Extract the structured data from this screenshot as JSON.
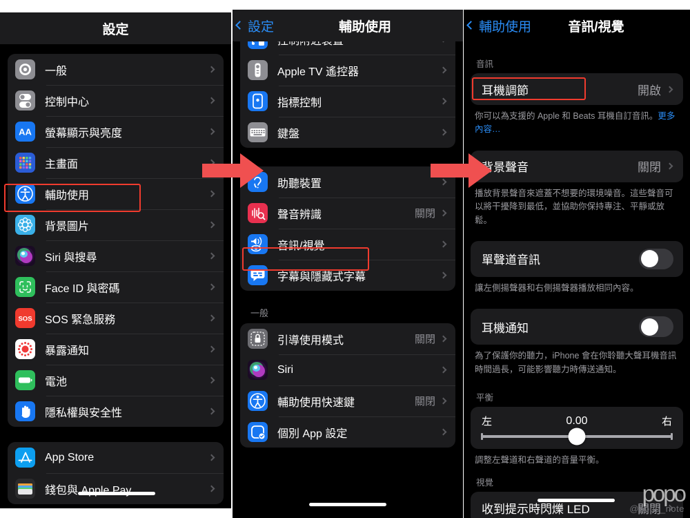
{
  "panel1": {
    "nav": {
      "title": "設定"
    },
    "groups": [
      {
        "rows": [
          {
            "label": "一般",
            "icon": "gear-icon",
            "icon_bg": "#8e8e93",
            "value": ""
          },
          {
            "label": "控制中心",
            "icon": "control-center-icon",
            "icon_bg": "#8e8e93",
            "value": ""
          },
          {
            "label": "螢幕顯示與亮度",
            "icon": "display-brightness-icon",
            "icon_bg": "#1877f2",
            "value": ""
          },
          {
            "label": "主畫面",
            "icon": "home-screen-icon",
            "icon_bg": "#2b5cd6",
            "value": ""
          },
          {
            "label": "輔助使用",
            "icon": "accessibility-icon",
            "icon_bg": "#1877f2",
            "value": ""
          },
          {
            "label": "背景圖片",
            "icon": "wallpaper-icon",
            "icon_bg": "#3ab0e8",
            "value": ""
          },
          {
            "label": "Siri 與搜尋",
            "icon": "siri-icon",
            "icon_bg": "#1a0b24",
            "value": ""
          },
          {
            "label": "Face ID 與密碼",
            "icon": "faceid-icon",
            "icon_bg": "#2fbf5c",
            "value": ""
          },
          {
            "label": "SOS 緊急服務",
            "icon": "sos-icon",
            "icon_bg": "#f03a2e",
            "value": ""
          },
          {
            "label": "暴露通知",
            "icon": "exposure-notification-icon",
            "icon_bg": "#ffffff",
            "value": ""
          },
          {
            "label": "電池",
            "icon": "battery-icon",
            "icon_bg": "#2fbf5c",
            "value": ""
          },
          {
            "label": "隱私權與安全性",
            "icon": "privacy-hand-icon",
            "icon_bg": "#1877f2",
            "value": ""
          }
        ]
      },
      {
        "rows": [
          {
            "label": "App Store",
            "icon": "app-store-icon",
            "icon_bg": "#0d9ff0",
            "value": ""
          },
          {
            "label": "錢包與 Apple Pay",
            "icon": "wallet-icon",
            "icon_bg": "#2b2b2d",
            "value": ""
          }
        ]
      }
    ]
  },
  "panel2": {
    "nav": {
      "back": "設定",
      "title": "輔助使用"
    },
    "groups": [
      {
        "clipped": true,
        "rows": [
          {
            "label": "控制附近裝置",
            "icon": "nearby-devices-icon",
            "icon_bg": "#1877f2",
            "value": ""
          },
          {
            "label": "Apple TV 遙控器",
            "icon": "apple-tv-remote-icon",
            "icon_bg": "#8e8e93",
            "value": ""
          },
          {
            "label": "指標控制",
            "icon": "pointer-control-icon",
            "icon_bg": "#1877f2",
            "value": ""
          },
          {
            "label": "鍵盤",
            "icon": "keyboard-icon",
            "icon_bg": "#8e8e93",
            "value": ""
          }
        ]
      },
      {
        "rows": [
          {
            "label": "助聽裝置",
            "icon": "hearing-devices-icon",
            "icon_bg": "#1877f2",
            "value": ""
          },
          {
            "label": "聲音辨識",
            "icon": "sound-recognition-icon",
            "icon_bg": "#e8304f",
            "value": "關閉"
          },
          {
            "label": "音訊/視覺",
            "icon": "audio-visual-icon",
            "icon_bg": "#1877f2",
            "value": ""
          },
          {
            "label": "字幕與隱藏式字幕",
            "icon": "subtitles-icon",
            "icon_bg": "#1877f2",
            "value": ""
          }
        ]
      },
      {
        "header": "一般",
        "rows": [
          {
            "label": "引導使用模式",
            "icon": "guided-access-icon",
            "icon_bg": "#6d6d72",
            "value": "關閉"
          },
          {
            "label": "Siri",
            "icon": "siri-icon",
            "icon_bg": "#1a0b24",
            "value": ""
          },
          {
            "label": "輔助使用快速鍵",
            "icon": "accessibility-shortcut-icon",
            "icon_bg": "#1877f2",
            "value": "關閉"
          },
          {
            "label": "個別 App 設定",
            "icon": "per-app-settings-icon",
            "icon_bg": "#1877f2",
            "value": ""
          }
        ]
      }
    ]
  },
  "panel3": {
    "nav": {
      "back": "輔助使用",
      "title": "音訊/視覺"
    },
    "section_audio_label": "音訊",
    "headphone_accommodations": {
      "label": "耳機調節",
      "value": "開啟"
    },
    "headphone_footnote": "你可以為支援的 Apple 和 Beats 耳機自訂音訊。",
    "headphone_footnote_link": "更多內容…",
    "background_sounds": {
      "label": "背景聲音",
      "value": "關閉"
    },
    "background_sounds_footnote": "播放背景聲音來遮蓋不想要的環境噪音。這些聲音可以將干擾降到最低，並協助你保持專注、平靜或放鬆。",
    "mono_audio": {
      "label": "單聲道音訊",
      "state": "off"
    },
    "mono_audio_footnote": "讓左側揚聲器和右側揚聲器播放相同內容。",
    "headphone_notifications": {
      "label": "耳機通知",
      "state": "off"
    },
    "headphone_notifications_footnote": "為了保護你的聽力，iPhone 會在你聆聽大聲耳機音訊時間過長，可能影響聽力時傳送通知。",
    "balance_label": "平衡",
    "balance": {
      "left": "左",
      "right": "右",
      "value": "0.00",
      "position_pct": 50
    },
    "balance_footnote": "調整左聲道和右聲道的音量平衡。",
    "section_visual_label": "視覺",
    "led_flash": {
      "label": "收到提示時閃爍 LED",
      "value": "關閉"
    }
  },
  "annotations": {
    "highlights": [
      {
        "name": "highlight-accessibility-row"
      },
      {
        "name": "highlight-audio-visual-row"
      },
      {
        "name": "highlight-headphone-accommodations-row"
      }
    ],
    "arrows": [
      {
        "name": "arrow-step-1"
      },
      {
        "name": "arrow-step-2"
      }
    ],
    "accent_red": "#f05050",
    "highlight_red": "#f13b2e"
  },
  "watermark": {
    "logo": "popo",
    "handle": "@popo_note"
  }
}
